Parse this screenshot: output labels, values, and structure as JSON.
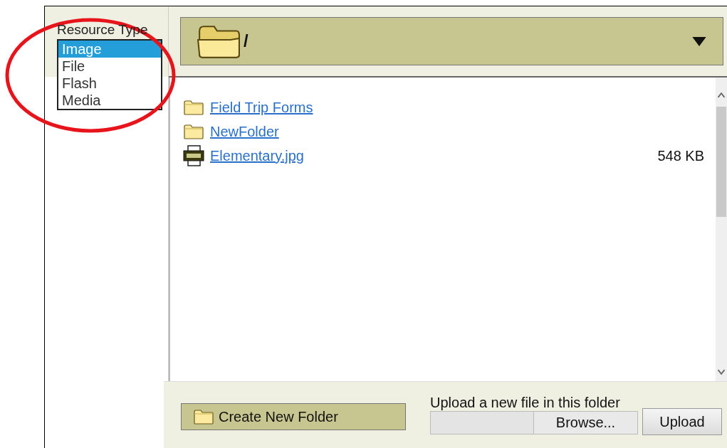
{
  "resource_type": {
    "label": "Resource Type",
    "options": [
      {
        "label": "Image",
        "selected": true
      },
      {
        "label": "File",
        "selected": false
      },
      {
        "label": "Flash",
        "selected": false
      },
      {
        "label": "Media",
        "selected": false
      }
    ]
  },
  "highlight": {
    "kind": "ellipse"
  },
  "path_bar": {
    "path": "/"
  },
  "files": [
    {
      "kind": "folder",
      "name": "Field Trip Forms"
    },
    {
      "kind": "folder",
      "name": "NewFolder"
    },
    {
      "kind": "jpg",
      "name": "Elementary.jpg",
      "size": "548 KB"
    }
  ],
  "create_folder_button": "Create New Folder",
  "upload": {
    "label": "Upload a new file in this folder",
    "browse_button": "Browse...",
    "upload_button": "Upload"
  }
}
